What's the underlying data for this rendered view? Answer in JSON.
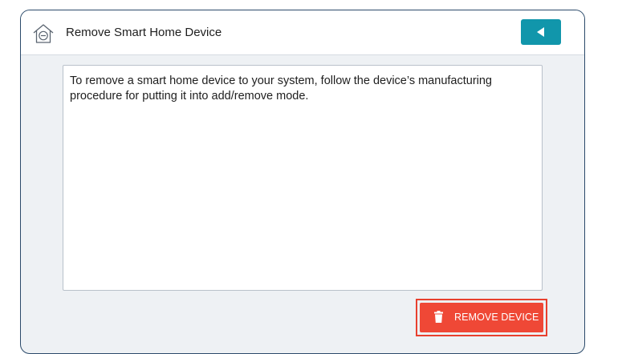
{
  "header": {
    "title": "Remove Smart Home Device",
    "icon": "home-remove-icon",
    "back_icon": "back-arrow-icon"
  },
  "content": {
    "instructions": "To remove a smart home device to your system, follow the device’s manufacturing procedure for putting it into add/remove mode."
  },
  "actions": {
    "remove_label": "REMOVE DEVICE",
    "remove_icon": "trash-icon"
  },
  "colors": {
    "accent": "#1196ab",
    "danger": "#ef4836",
    "border": "#2b4a6a",
    "background": "#eef1f4"
  }
}
